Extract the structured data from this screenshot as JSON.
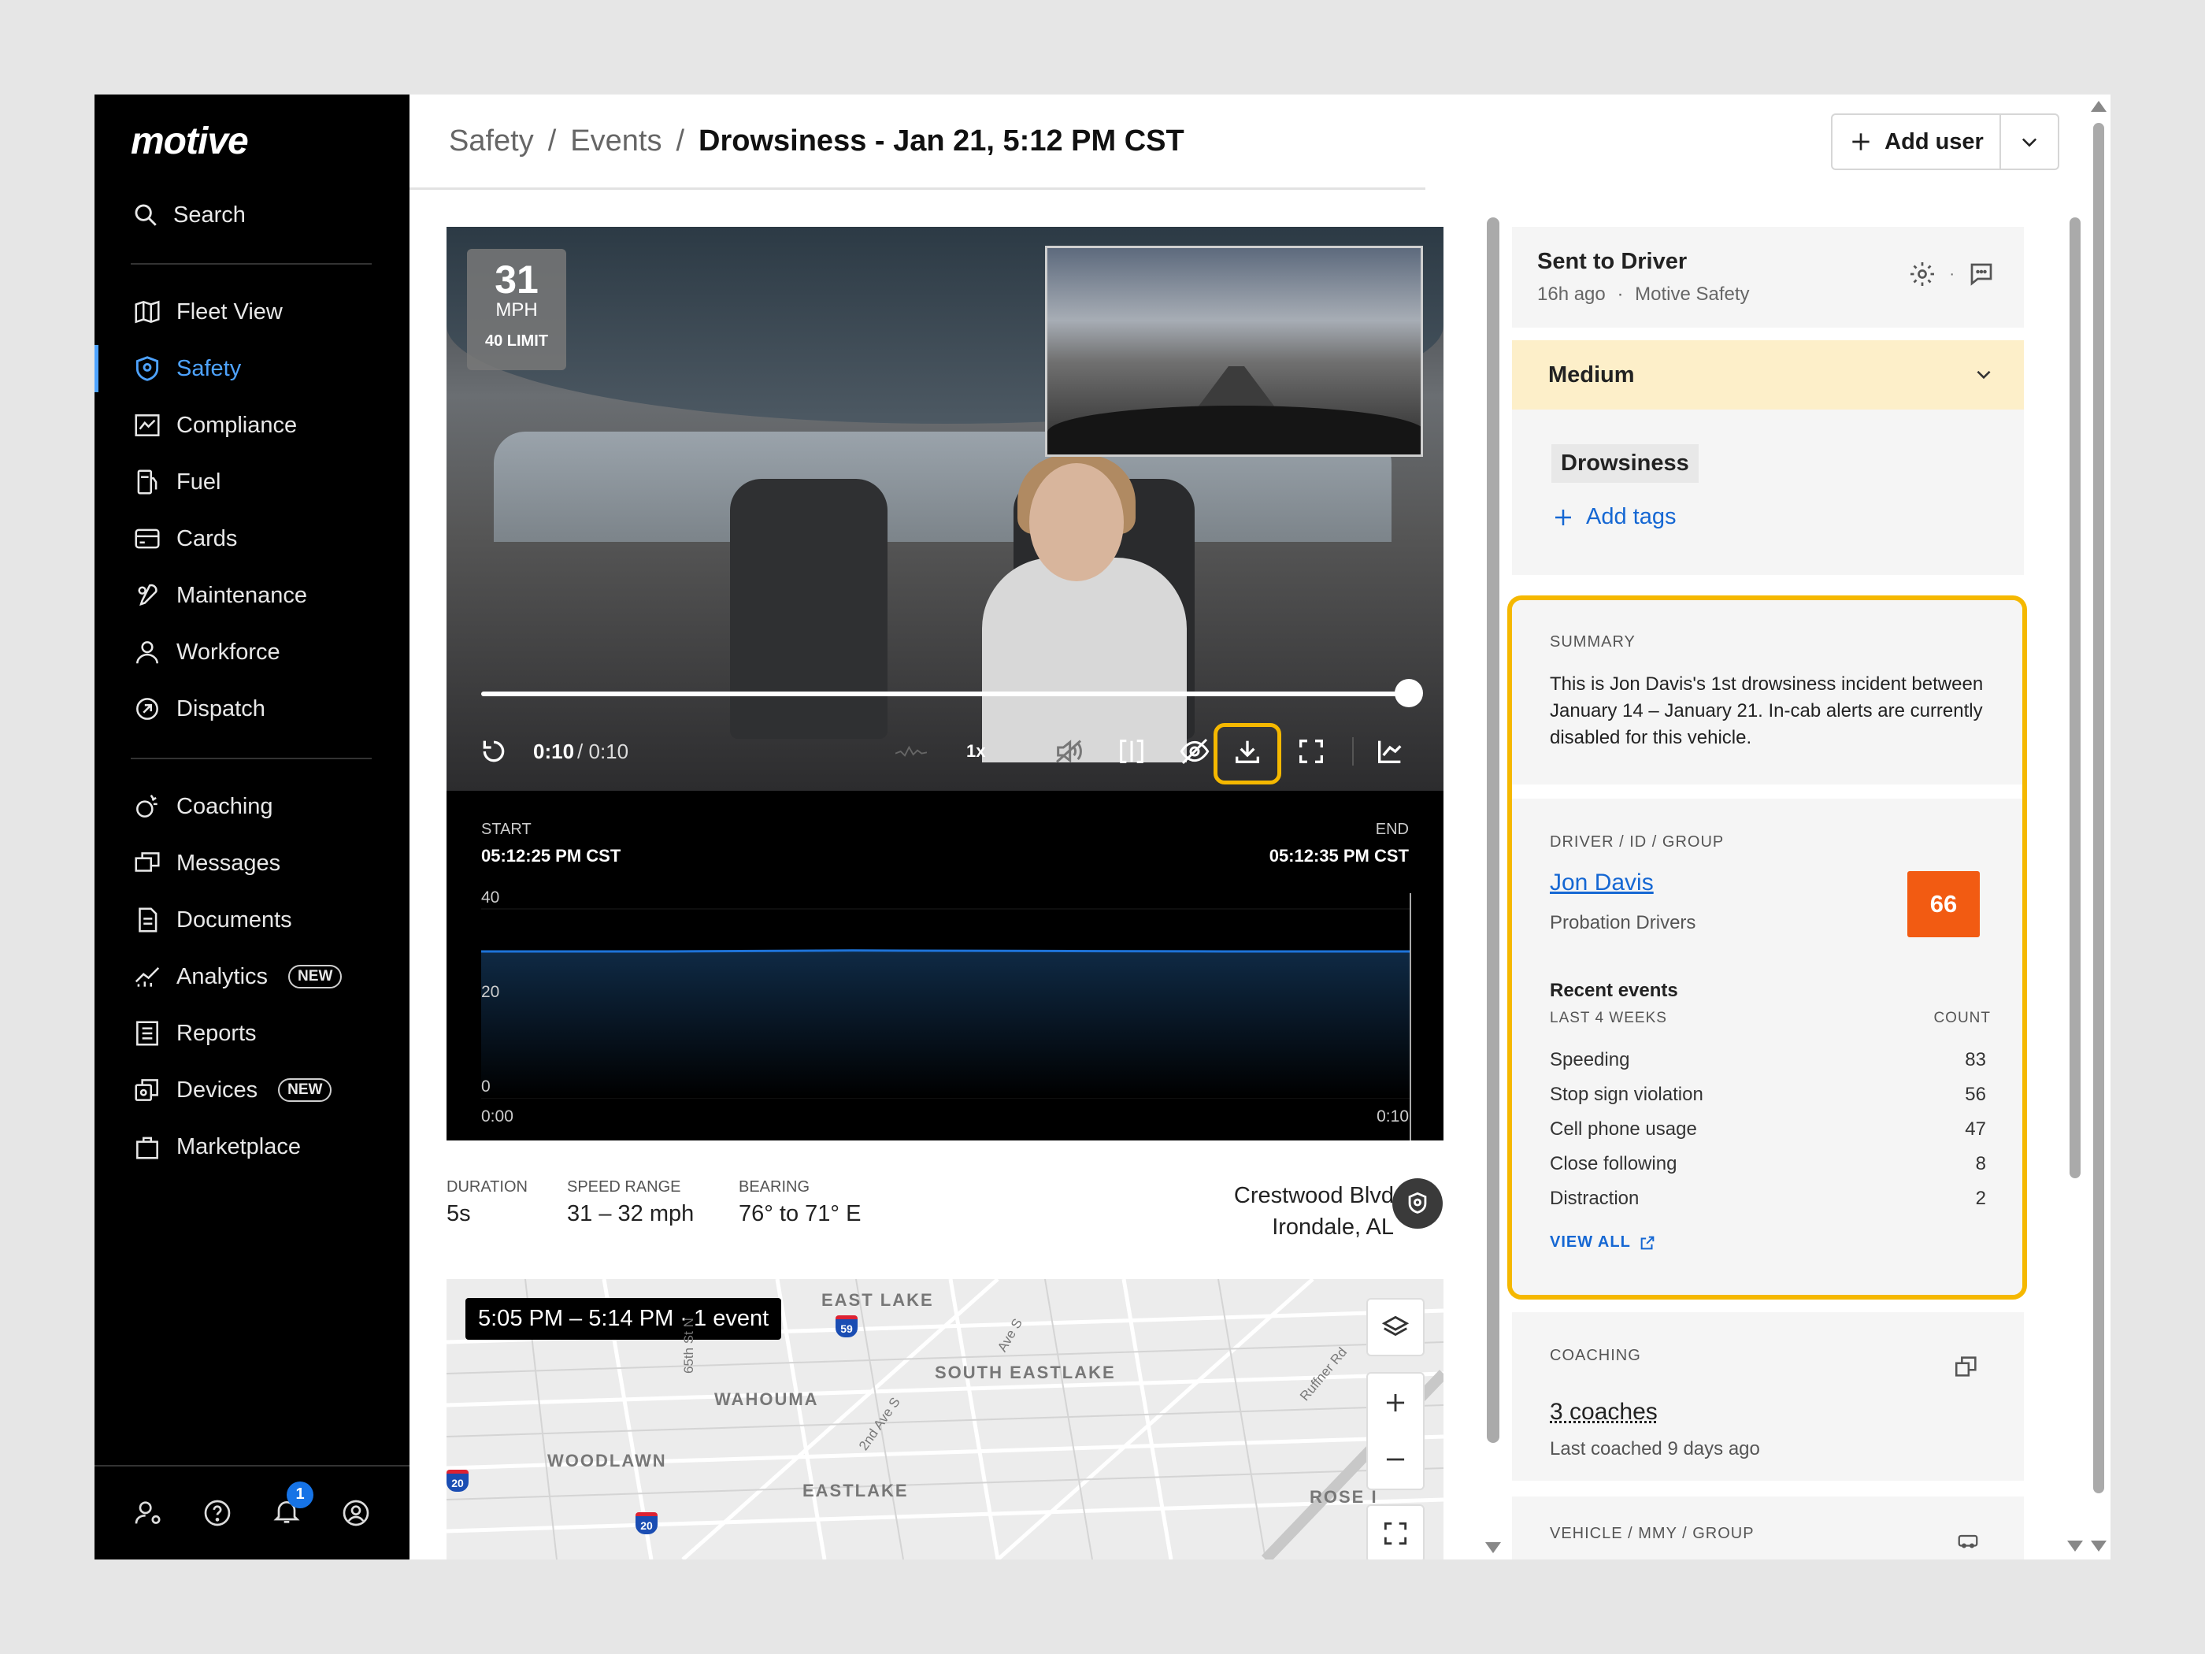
{
  "brand": "motive",
  "sidebar": {
    "search_label": "Search",
    "items_main": [
      {
        "label": "Fleet View",
        "icon": "map-icon"
      },
      {
        "label": "Safety",
        "icon": "shield-icon",
        "active": true
      },
      {
        "label": "Compliance",
        "icon": "chart-box-icon"
      },
      {
        "label": "Fuel",
        "icon": "fuel-icon"
      },
      {
        "label": "Cards",
        "icon": "card-icon"
      },
      {
        "label": "Maintenance",
        "icon": "wrench-icon"
      },
      {
        "label": "Workforce",
        "icon": "person-icon"
      },
      {
        "label": "Dispatch",
        "icon": "dispatch-icon"
      }
    ],
    "items_secondary": [
      {
        "label": "Coaching",
        "icon": "coaching-icon"
      },
      {
        "label": "Messages",
        "icon": "messages-icon"
      },
      {
        "label": "Documents",
        "icon": "document-icon"
      },
      {
        "label": "Analytics",
        "icon": "analytics-icon",
        "badge": "NEW"
      },
      {
        "label": "Reports",
        "icon": "reports-icon"
      },
      {
        "label": "Devices",
        "icon": "devices-icon",
        "badge": "NEW"
      },
      {
        "label": "Marketplace",
        "icon": "bag-icon"
      }
    ],
    "notification_count": "1"
  },
  "header": {
    "breadcrumb": [
      "Safety",
      "Events",
      "Drowsiness - Jan 21, 5:12 PM CST"
    ],
    "separator": "/",
    "add_user_label": "Add user"
  },
  "video": {
    "speed": "31",
    "speed_unit": "MPH",
    "limit": "40 LIMIT",
    "current_time": "0:10",
    "duration": "/ 0:10",
    "playback_rate": "1x",
    "progress": 1.0
  },
  "graph": {
    "start_label": "START",
    "start_time": "05:12:25 PM CST",
    "end_label": "END",
    "end_time": "05:12:35 PM CST",
    "y_ticks": [
      "40",
      "20",
      "0"
    ],
    "x_start": "0:00",
    "x_end": "0:10",
    "line_color": "#1e73d8"
  },
  "chart_data": {
    "type": "line",
    "x": [
      0,
      2,
      4,
      6,
      8,
      10
    ],
    "values": [
      31,
      31,
      31.2,
      31.1,
      31,
      31
    ],
    "ylim": [
      0,
      40
    ],
    "xlim": [
      0,
      10
    ]
  },
  "stats": {
    "duration_k": "DURATION",
    "duration_v": "5s",
    "speed_k": "SPEED RANGE",
    "speed_v": "31 – 32 mph",
    "bearing_k": "BEARING",
    "bearing_v": "76° to 71° E",
    "location_line1": "Crestwood Blvd",
    "location_line2": "Irondale, AL"
  },
  "map": {
    "pill": "5:05 PM – 5:14 PM · 1 event",
    "labels": [
      "EAST LAKE",
      "SOUTH EASTLAKE",
      "WAHOUMA",
      "WOODLAWN",
      "EASTLAKE",
      "ROSE I"
    ],
    "streets": [
      "65th St N",
      "Ave S",
      "2nd Ave S",
      "Ruffner Rd"
    ],
    "shields": [
      "59",
      "20",
      "20"
    ]
  },
  "right": {
    "sent_title": "Sent to Driver",
    "sent_time": "16h ago",
    "sent_dot": "·",
    "sent_by": "Motive Safety",
    "severity": "Medium",
    "tag": "Drowsiness",
    "add_tags": "Add tags",
    "summary_label": "SUMMARY",
    "summary_text": "This is Jon Davis's 1st drowsiness incident between January 14 – January 21. In-cab alerts are currently disabled for this vehicle.",
    "driver_label": "DRIVER / ID / GROUP",
    "driver_name": "Jon Davis",
    "driver_group": "Probation Drivers",
    "driver_score": "66",
    "recent_title": "Recent events",
    "recent_period": "LAST 4 WEEKS",
    "recent_count_label": "COUNT",
    "events": [
      {
        "name": "Speeding",
        "count": "83"
      },
      {
        "name": "Stop sign violation",
        "count": "56"
      },
      {
        "name": "Cell phone usage",
        "count": "47"
      },
      {
        "name": "Close following",
        "count": "8"
      },
      {
        "name": "Distraction",
        "count": "2"
      }
    ],
    "view_all": "VIEW ALL",
    "coaching_label": "COACHING",
    "coaches": "3 coaches",
    "last_coached": "Last coached 9 days ago",
    "vehicle_label": "VEHICLE / MMY / GROUP"
  }
}
